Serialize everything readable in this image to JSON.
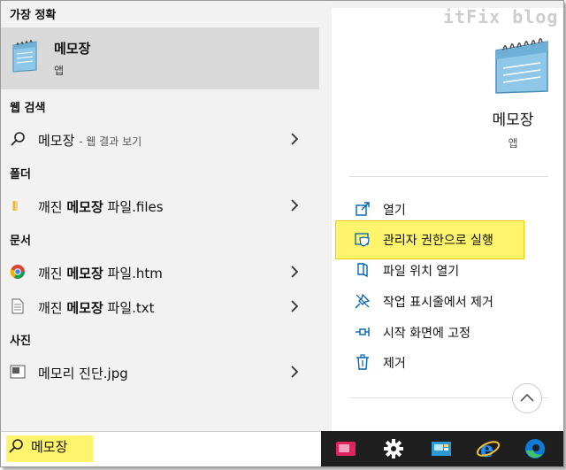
{
  "watermark": "itFix blog",
  "sections": {
    "best_match": "가장 정확",
    "web_search": "웹 검색",
    "folders": "폴더",
    "documents": "문서",
    "photos": "사진"
  },
  "best_match": {
    "title": "메모장",
    "subtitle": "앱"
  },
  "web_result": {
    "query": "메모장",
    "suffix": "- 웹 결과 보기"
  },
  "folder_item": {
    "prefix": "깨진 ",
    "bold": "메모장",
    "suffix": " 파일.files"
  },
  "documents": [
    {
      "prefix": "깨진 ",
      "bold": "메모장",
      "suffix": " 파일.htm",
      "icon": "chrome-icon"
    },
    {
      "prefix": "깨진 ",
      "bold": "메모장",
      "suffix": " 파일.txt",
      "icon": "text-file-icon"
    }
  ],
  "photo_item": {
    "label": "메모리 진단.jpg"
  },
  "search": {
    "value": "메모장"
  },
  "preview": {
    "title": "메모장",
    "subtitle": "앱"
  },
  "actions": [
    {
      "label": "열기",
      "icon": "open-icon"
    },
    {
      "label": "관리자 권한으로 실행",
      "icon": "shield-icon"
    },
    {
      "label": "파일 위치 열기",
      "icon": "folder-location-icon"
    },
    {
      "label": "작업 표시줄에서 제거",
      "icon": "unpin-taskbar-icon"
    },
    {
      "label": "시작 화면에 고정",
      "icon": "pin-start-icon"
    },
    {
      "label": "제거",
      "icon": "trash-icon"
    }
  ],
  "taskbar": [
    "media-app-icon",
    "settings-gear-icon",
    "photos-app-icon",
    "internet-explorer-icon",
    "edge-icon"
  ],
  "colors": {
    "highlight": "#fff46b",
    "accent": "#0063b1",
    "selected": "#d9d9d9"
  }
}
